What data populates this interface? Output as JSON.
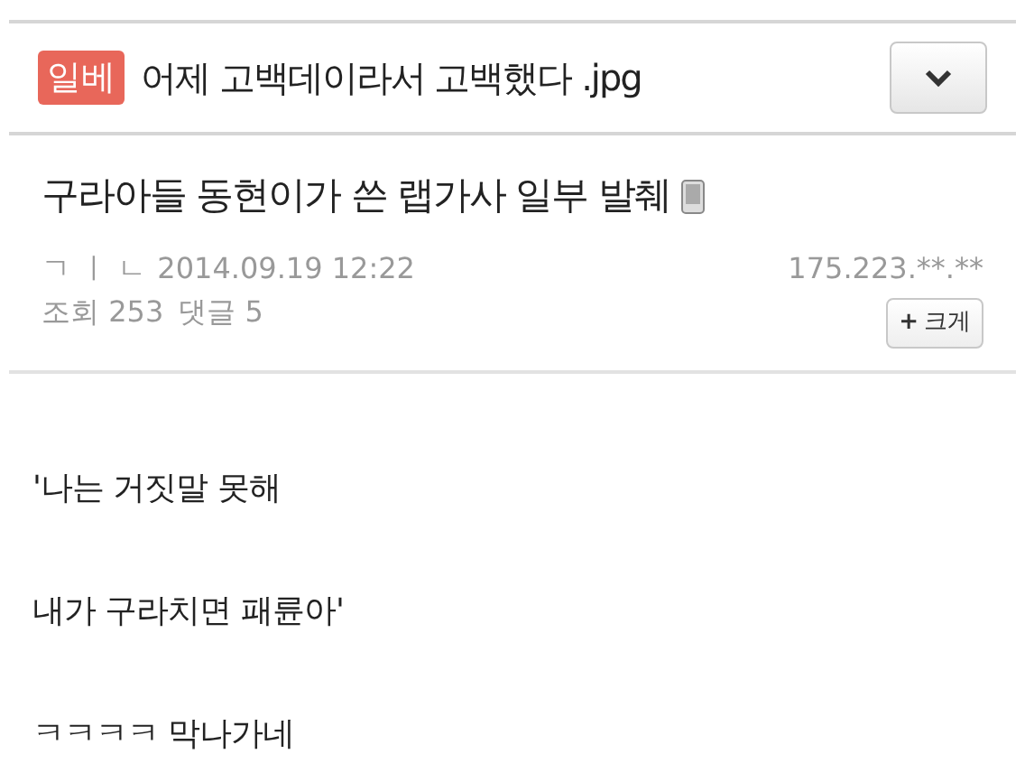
{
  "board": {
    "badge": "일베",
    "title": "어제 고백데이라서 고백했다 .jpg"
  },
  "post": {
    "title": "구라아들 동현이가 쓴 랩가사 일부 발췌",
    "author": "ㄱ ㅣ ㄴ",
    "date": "2014.09.19 12:22",
    "ip": "175.223.**.**",
    "views_label": "조회",
    "views": "253",
    "comments_label": "댓글",
    "comments": "5",
    "zoom_icon": "+",
    "zoom_label": "크게"
  },
  "body": [
    "'나는 거짓말 못해",
    "내가 구라치면 패륜아'",
    "ㅋㅋㅋㅋ 막나가네"
  ]
}
